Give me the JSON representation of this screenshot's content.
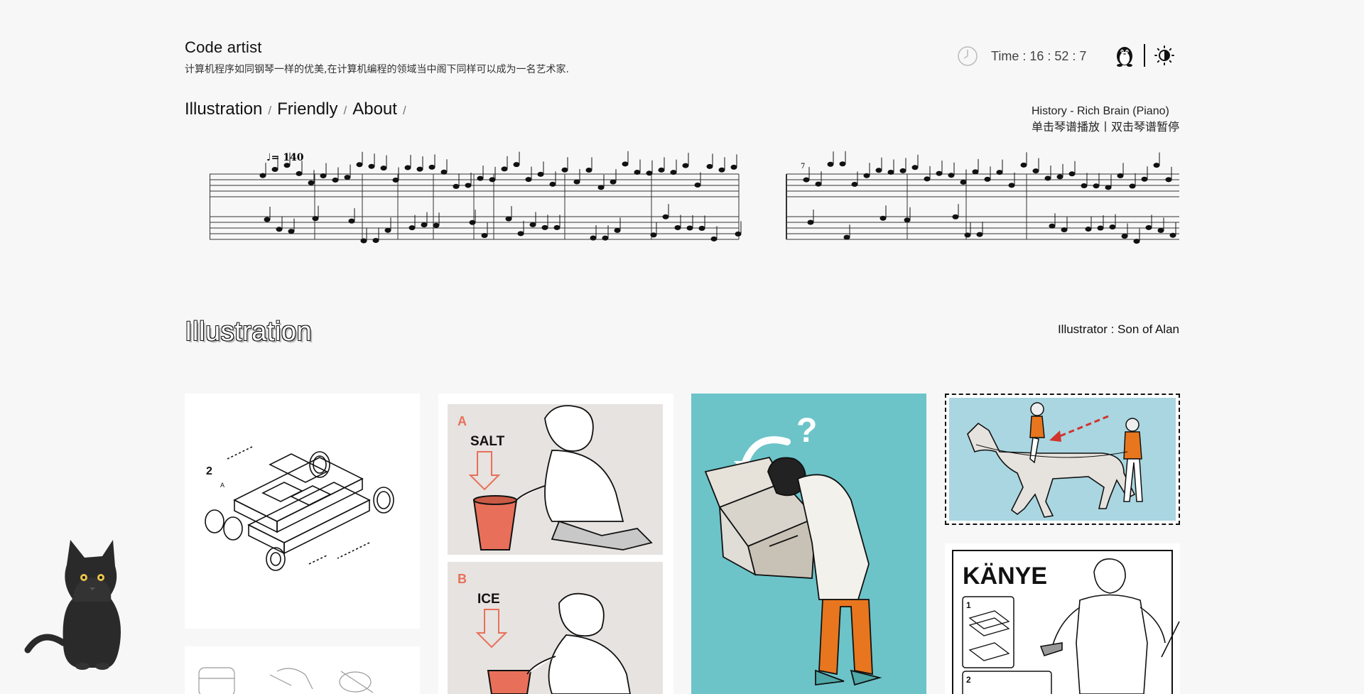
{
  "header": {
    "title": "Code artist",
    "subtitle": "计算机程序如同钢琴一样的优美,在计算机编程的领域当中阁下同样可以成为一名艺术家.",
    "time_label": "Time : 16 : 52 : 7"
  },
  "icons": {
    "clock": "clock-icon",
    "penguin": "penguin-icon",
    "theme": "sun-icon"
  },
  "nav": {
    "items": [
      {
        "label": "Illustration"
      },
      {
        "label": "Friendly"
      },
      {
        "label": "About"
      }
    ],
    "separator": "/"
  },
  "music": {
    "song": "History - Rich Brain (Piano)",
    "hint": "单击琴谱播放丨双击琴谱暂停",
    "tempo": "♩= 140",
    "measure_number": "7"
  },
  "section": {
    "title": "Illustration",
    "illustrator": "Illustrator : Son of Alan"
  },
  "gallery": {
    "salt_letter": "A",
    "salt_label": "SALT",
    "ice_letter": "B",
    "ice_label": "ICE",
    "kanye_label": "KÄNYE",
    "assembly_step": "2",
    "assembly_part": "A",
    "kanye_step1": "1",
    "kanye_step2": "2",
    "question": "?"
  },
  "colors": {
    "background": "#f7f7f7",
    "teal": "#6cc4c9",
    "orange": "#e8761e",
    "salmon": "#e8705a",
    "sky": "#a9d6e1"
  }
}
